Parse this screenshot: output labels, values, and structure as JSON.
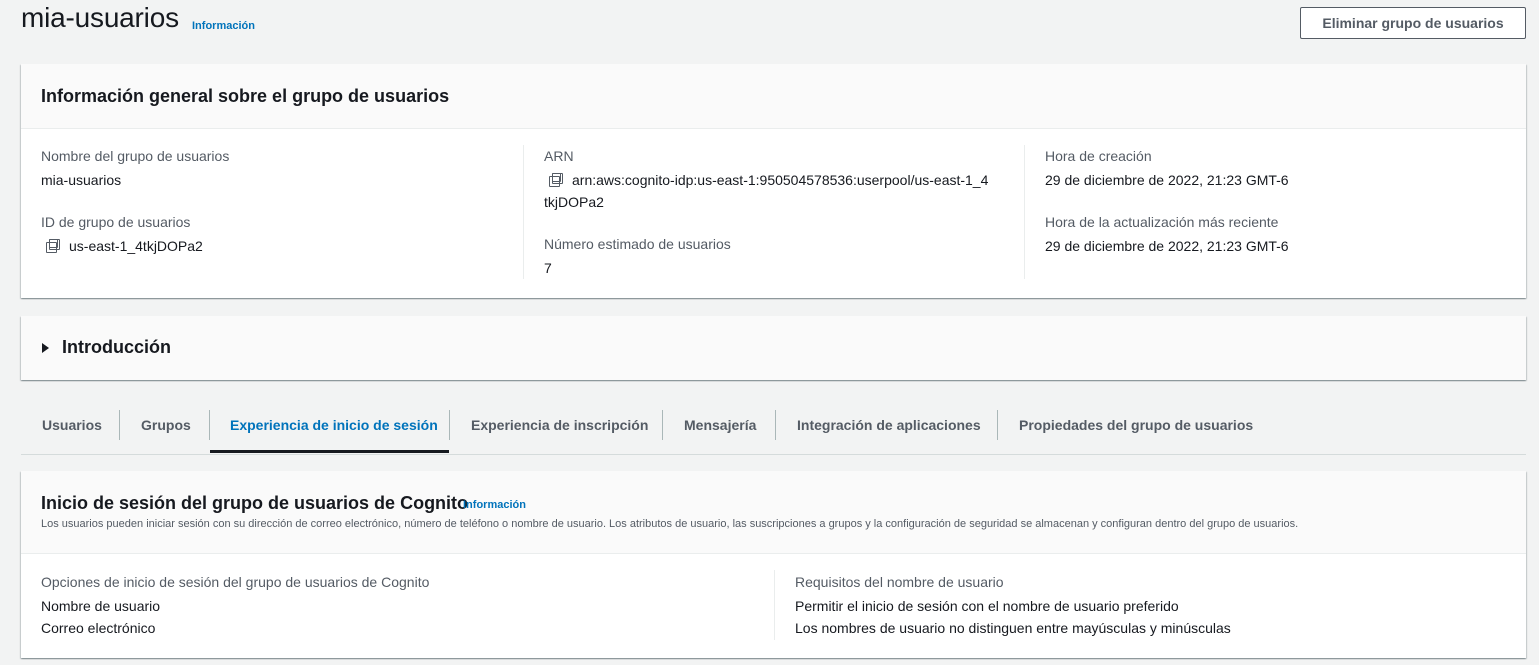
{
  "header": {
    "title": "mia-usuarios",
    "info_link": "Información",
    "delete_button": "Eliminar grupo de usuarios"
  },
  "overview": {
    "title": "Información general sobre el grupo de usuarios",
    "pool_name_label": "Nombre del grupo de usuarios",
    "pool_name_value": "mia-usuarios",
    "pool_id_label": "ID de grupo de usuarios",
    "pool_id_value": "us-east-1_4tkjDOPa2",
    "arn_label": "ARN",
    "arn_value_line1": "arn:aws:cognito-idp:us-east-1:950504578536:userpool/us-east-1_4",
    "arn_value_line2": "tkjDOPa2",
    "users_label": "Número estimado de usuarios",
    "users_value": "7",
    "created_label": "Hora de creación",
    "created_value": "29 de diciembre de 2022, 21:23 GMT-6",
    "updated_label": "Hora de la actualización más reciente",
    "updated_value": "29 de diciembre de 2022, 21:23 GMT-6"
  },
  "intro": {
    "title": "Introducción"
  },
  "tabs": [
    {
      "label": "Usuarios"
    },
    {
      "label": "Grupos"
    },
    {
      "label": "Experiencia de inicio de sesión"
    },
    {
      "label": "Experiencia de inscripción"
    },
    {
      "label": "Mensajería"
    },
    {
      "label": "Integración de aplicaciones"
    },
    {
      "label": "Propiedades del grupo de usuarios"
    }
  ],
  "signin": {
    "title": "Inicio de sesión del grupo de usuarios de Cognito",
    "info_link": "Información",
    "description": "Los usuarios pueden iniciar sesión con su dirección de correo electrónico, número de teléfono o nombre de usuario. Los atributos de usuario, las suscripciones a grupos y la configuración de seguridad se almacenan y configuran dentro del grupo de usuarios.",
    "options_label": "Opciones de inicio de sesión del grupo de usuarios de Cognito",
    "options_values": [
      "Nombre de usuario",
      "Correo electrónico"
    ],
    "requirements_label": "Requisitos del nombre de usuario",
    "requirements_values": [
      "Permitir el inicio de sesión con el nombre de usuario preferido",
      "Los nombres de usuario no distinguen entre mayúsculas y minúsculas"
    ]
  }
}
